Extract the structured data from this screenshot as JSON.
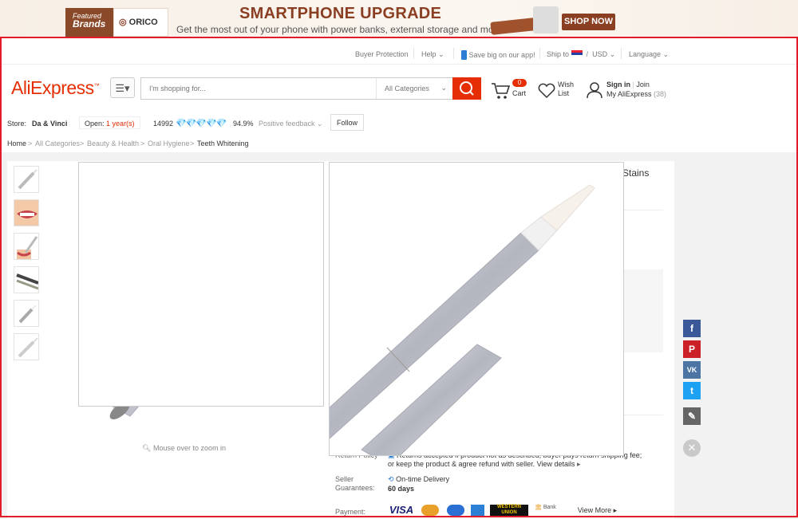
{
  "banner": {
    "featured_line1": "Featured",
    "featured_line2": "Brands",
    "brand": "ORICO",
    "title": "SMARTPHONE UPGRADE",
    "subtitle": "Get the most out of your phone with power banks, external storage and more",
    "cta": "SHOP NOW"
  },
  "topnav": {
    "buyer_protection": "Buyer Protection",
    "help": "Help",
    "app_promo": "Save big on our app!",
    "ship_to": "Ship to",
    "currency": "USD",
    "language": "Language"
  },
  "header": {
    "logo": "AliExpress",
    "search_placeholder": "I'm shopping for...",
    "category_select": "All Categories",
    "cart_count": "0",
    "cart_label": "Cart",
    "wish_line1": "Wish",
    "wish_line2": "List",
    "sign_in": "Sign in",
    "join": "Join",
    "my_aliexpress": "My AliExpress",
    "my_count": "(38)"
  },
  "store": {
    "label": "Store:",
    "name": "Da & Vinci",
    "open_label": "Open:",
    "open_years": "1 year(s)",
    "score": "14992",
    "feedback_pct": "94.9%",
    "feedback_label": "Positive feedback",
    "follow": "Follow"
  },
  "breadcrumb": [
    "Home",
    "All Categories",
    "Beauty & Health",
    "Oral Hygiene",
    "Teeth Whitening"
  ],
  "product": {
    "title_fragment": "Stains",
    "zoom_hint": "Mouse over to zoom in",
    "return_label": "Return Policy",
    "return_text_1": "Returns accepted if product not as described, buyer pays return shipping fee;",
    "return_text_2": "or keep the product & agree refund with seller.",
    "view_details": "View details",
    "guarantee_label_1": "Seller",
    "guarantee_label_2": "Guarantees:",
    "guarantee_name": "On-time Delivery",
    "guarantee_days": "60 days",
    "payment_label": "Payment:",
    "payment_methods": [
      "VISA",
      "MasterCard",
      "Maestro",
      "AmEx",
      "WESTERN UNION",
      "Bank Transfer"
    ],
    "view_more": "View More"
  },
  "social": [
    "facebook-icon",
    "pinterest-icon",
    "vk-icon",
    "twitter-icon",
    "edit-icon"
  ],
  "colors": {
    "brand": "#e62e04",
    "frame": "#e21b28",
    "diamond": "#2eaee6",
    "banner_brown": "#8a3e22"
  }
}
